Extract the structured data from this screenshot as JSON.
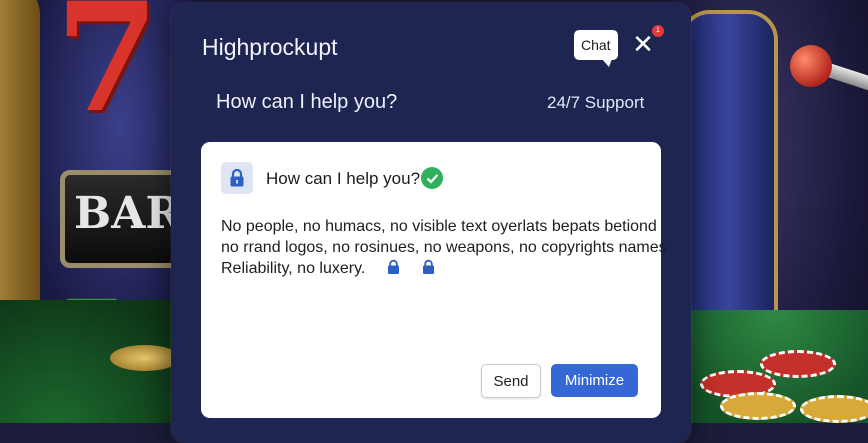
{
  "background": {
    "reel_left_symbol": "7",
    "reel_bar_text": "BAR"
  },
  "modal": {
    "title": "Highprockupt",
    "chat_label": "Chat",
    "close_glyph": "✕",
    "notification_badge": "1",
    "subtitle": "How can I help you?",
    "support_label": "24/7 Support"
  },
  "card": {
    "heading": "How can I help you?",
    "body_lines": [
      "No people, no humacs, no visible text oyerlats bepats betiond",
      "no rrand logos, no rosinues, no weapons, no copyrights names",
      "Reliability, no luxery."
    ],
    "send_label": "Send",
    "minimize_label": "Minimize"
  },
  "colors": {
    "modal_bg": "#1e2550",
    "accent_button": "#3568d4",
    "check_green": "#2fb05a",
    "notification_red": "#e23a3a",
    "lock_blue": "#2d5fc4"
  },
  "icons": [
    "lock-icon",
    "check-icon",
    "close-icon",
    "chat-bubble-icon"
  ]
}
